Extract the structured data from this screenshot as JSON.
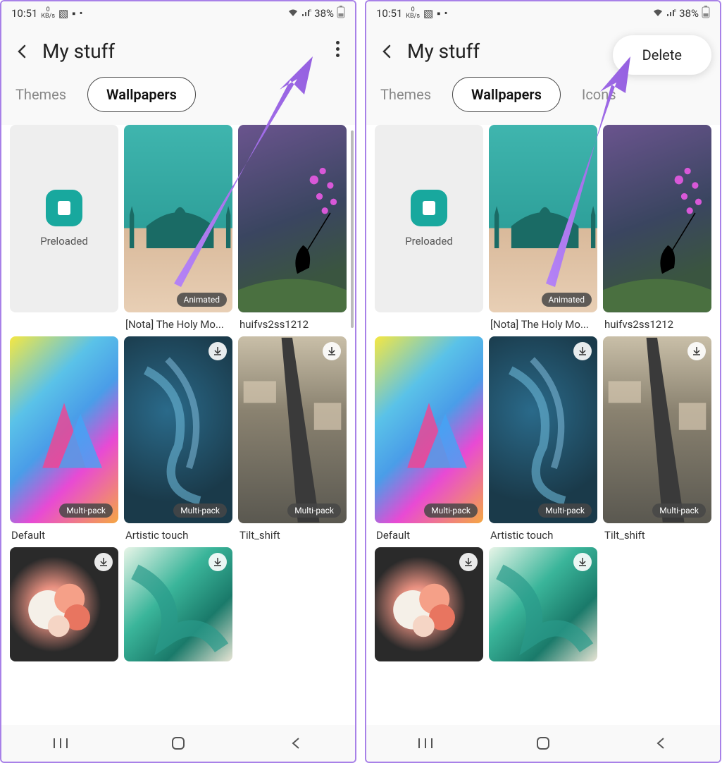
{
  "status": {
    "time": "10:51",
    "kbs_top": "0",
    "kbs_bottom": "KB/s",
    "battery": "38%"
  },
  "header": {
    "title": "My stuff"
  },
  "menu": {
    "delete": "Delete"
  },
  "tabs": {
    "themes": "Themes",
    "wallpapers": "Wallpapers",
    "icons": "Icons"
  },
  "items": {
    "preloaded": "Preloaded",
    "nota": "[Nota] The Holy Mo...",
    "huif": "huifvs2ss1212",
    "default": "Default",
    "artistic": "Artistic touch",
    "tilt": "Tilt_shift"
  },
  "badges": {
    "animated": "Animated",
    "multipack": "Multi-pack"
  }
}
